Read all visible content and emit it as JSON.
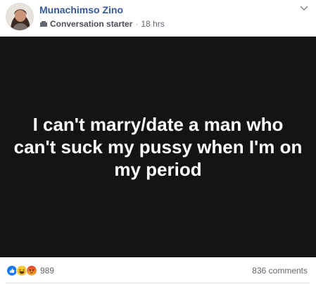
{
  "post": {
    "author_name": "Munachimso Zino",
    "badge_label": "Conversation starter",
    "separator": "·",
    "timestamp": "18 hrs",
    "body_text": "I can't marry/date a man who can't suck my pussy when I'm on my period",
    "background_color": "#141414"
  },
  "reactions": {
    "icons": [
      "like-icon",
      "haha-icon",
      "angry-icon"
    ],
    "count": "989"
  },
  "comments": {
    "label": "836 comments"
  },
  "colors": {
    "author_link": "#365899",
    "meta_text": "#616770",
    "like_blue": "#1877f2"
  }
}
